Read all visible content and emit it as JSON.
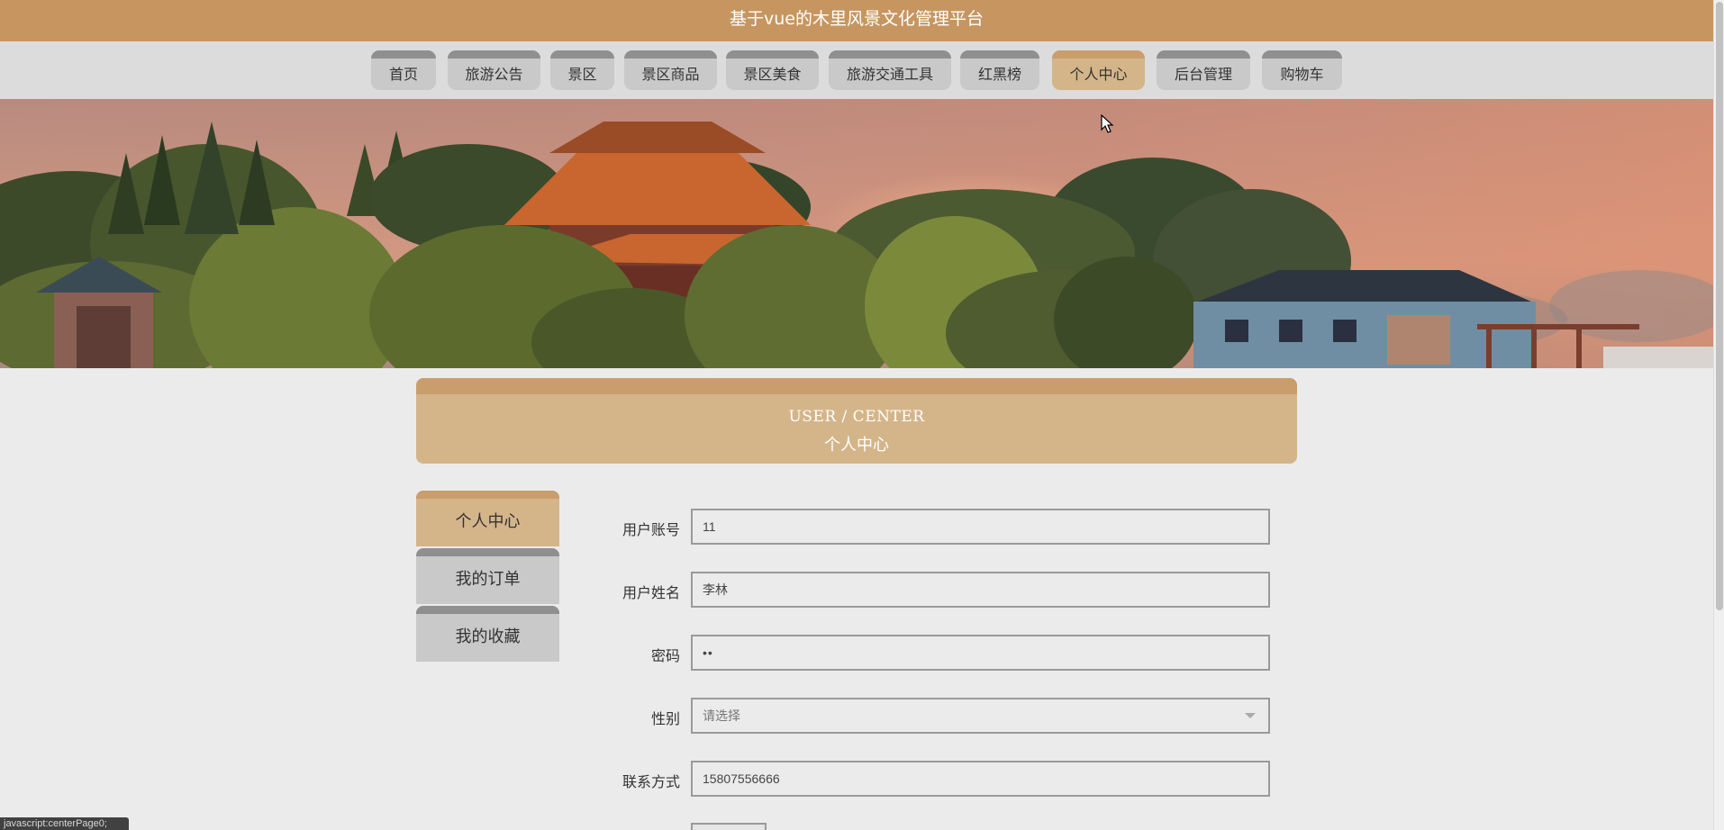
{
  "header": {
    "title": "基于vue的木里风景文化管理平台"
  },
  "nav": {
    "items": [
      {
        "label": "首页"
      },
      {
        "label": "旅游公告"
      },
      {
        "label": "景区"
      },
      {
        "label": "景区商品"
      },
      {
        "label": "景区美食"
      },
      {
        "label": "旅游交通工具"
      },
      {
        "label": "红黑榜"
      },
      {
        "label": "个人中心"
      },
      {
        "label": "后台管理"
      },
      {
        "label": "购物车"
      }
    ],
    "active": "个人中心"
  },
  "user_center": {
    "title_en": "USER / CENTER",
    "title_zh": "个人中心"
  },
  "sidebar": {
    "items": [
      {
        "label": "个人中心"
      },
      {
        "label": "我的订单"
      },
      {
        "label": "我的收藏"
      }
    ],
    "active": "个人中心"
  },
  "form": {
    "account": {
      "label": "用户账号",
      "value": "11"
    },
    "name": {
      "label": "用户姓名",
      "value": "李林"
    },
    "password": {
      "label": "密码",
      "value": "••"
    },
    "gender": {
      "label": "性别",
      "placeholder": "请选择"
    },
    "phone": {
      "label": "联系方式",
      "value": "15807556666"
    }
  },
  "status_bar": {
    "url": "javascript:centerPage0;"
  },
  "colors": {
    "brand": "#c79660",
    "active_tab": "#d4b58a",
    "tab": "#c9c9c9",
    "tab_top": "#8f8f8f"
  }
}
